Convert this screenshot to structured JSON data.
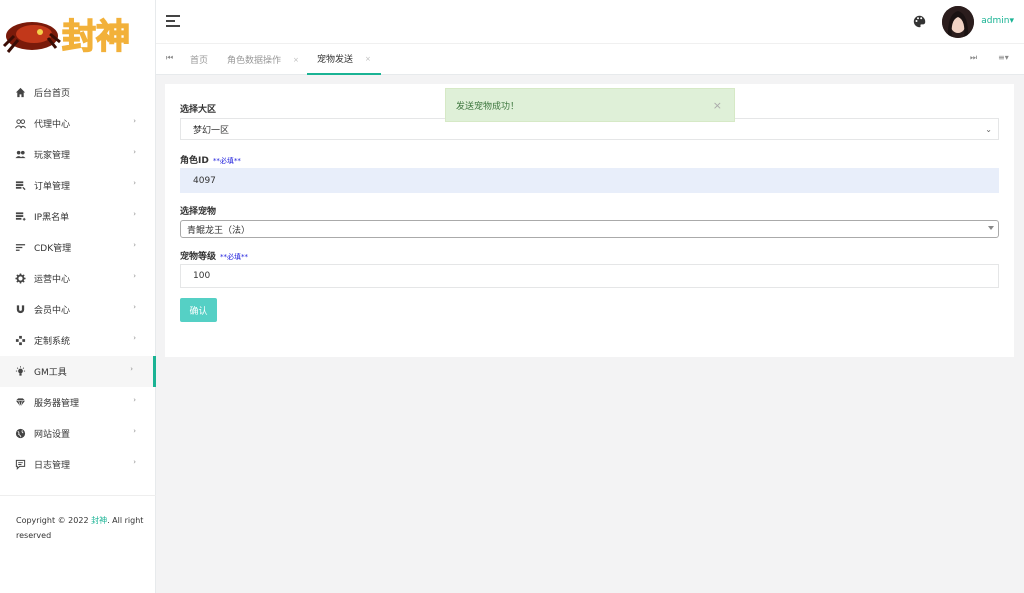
{
  "brand": {
    "logo_text": "封神"
  },
  "sidebar": {
    "items": [
      {
        "label": "后台首页",
        "icon": "home-icon",
        "has_caret": false
      },
      {
        "label": "代理中心",
        "icon": "agents-icon",
        "has_caret": true
      },
      {
        "label": "玩家管理",
        "icon": "players-icon",
        "has_caret": true
      },
      {
        "label": "订单管理",
        "icon": "orders-icon",
        "has_caret": true
      },
      {
        "label": "IP黑名单",
        "icon": "blacklist-icon",
        "has_caret": true
      },
      {
        "label": "CDK管理",
        "icon": "list-icon",
        "has_caret": true
      },
      {
        "label": "运营中心",
        "icon": "gear-icon",
        "has_caret": true
      },
      {
        "label": "会员中心",
        "icon": "magnet-icon",
        "has_caret": true
      },
      {
        "label": "定制系统",
        "icon": "puzzle-icon",
        "has_caret": true
      },
      {
        "label": "GM工具",
        "icon": "bulb-icon",
        "has_caret": true,
        "active": true
      },
      {
        "label": "服务器管理",
        "icon": "diamond-icon",
        "has_caret": true
      },
      {
        "label": "网站设置",
        "icon": "globe-icon",
        "has_caret": true
      },
      {
        "label": "日志管理",
        "icon": "comment-icon",
        "has_caret": true
      }
    ],
    "copyright_prefix": "Copyright © 2022",
    "copyright_brand": "封神",
    "copyright_suffix": ". All right reserved"
  },
  "header": {
    "username": "admin",
    "caret": "▾"
  },
  "tabs": {
    "prev": "⏮",
    "next": "⏭",
    "menu": "≡▾",
    "items": [
      {
        "label": "首页",
        "closable": false
      },
      {
        "label": "角色数据操作",
        "closable": true
      },
      {
        "label": "宠物发送",
        "closable": true,
        "active": true
      }
    ],
    "close_glyph": "×"
  },
  "form": {
    "region_label": "选择大区",
    "region_value": "梦幻一区",
    "role_label": "角色ID",
    "role_required": "**必填**",
    "role_value": "4097",
    "pet_label": "选择宠物",
    "pet_value": "青鲲龙王（法）",
    "level_label": "宠物等级",
    "level_required": "**必填**",
    "level_value": "100",
    "submit_label": "确认"
  },
  "alert": {
    "message": "发送宠物成功！",
    "close": "×"
  },
  "colors": {
    "accent": "#1ab394",
    "button": "#55d0c5",
    "alert_bg": "#dff0d8"
  }
}
